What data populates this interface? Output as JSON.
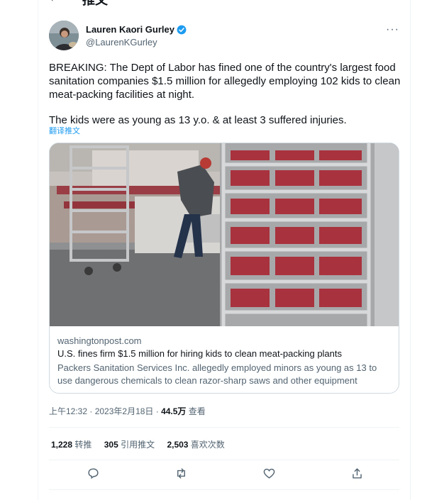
{
  "header": {
    "title": "推文",
    "back_icon": "arrow-left-icon"
  },
  "tweet": {
    "author_name": "Lauren Kaori Gurley",
    "author_handle": "@LaurenKGurley",
    "paragraph1": "BREAKING: The Dept of Labor has fined one of the country's largest food sanitation companies $1.5 million for allegedly employing 102 kids to clean meat-packing facilities at night.",
    "paragraph2": "The kids were as young as 13 y.o. & at least 3 suffered injuries.",
    "translate_label": "翻译推文"
  },
  "card": {
    "domain": "washingtonpost.com",
    "title": "U.S. fines firm $1.5 million for hiring kids to clean meat-packing plants",
    "description": "Packers Sanitation Services Inc. allegedly employed minors as young as 13 to use dangerous chemicals to clean razor-sharp saws and other equipment"
  },
  "meta": {
    "time": "上午12:32 · 2023年2月18日 · ",
    "views": "44.5万",
    "views_label": " 查看"
  },
  "stats": {
    "retweets": "1,228",
    "retweets_label": " 转推",
    "quotes": "305",
    "quotes_label": " 引用推文",
    "likes": "2,503",
    "likes_label": " 喜欢次数"
  },
  "actions": [
    "reply-icon",
    "retweet-icon",
    "like-icon",
    "share-icon"
  ],
  "colors": {
    "link": "#1d9bf0",
    "verified": "#1d9bf0",
    "secondary_text": "#536471",
    "border": "#cfd9de"
  }
}
